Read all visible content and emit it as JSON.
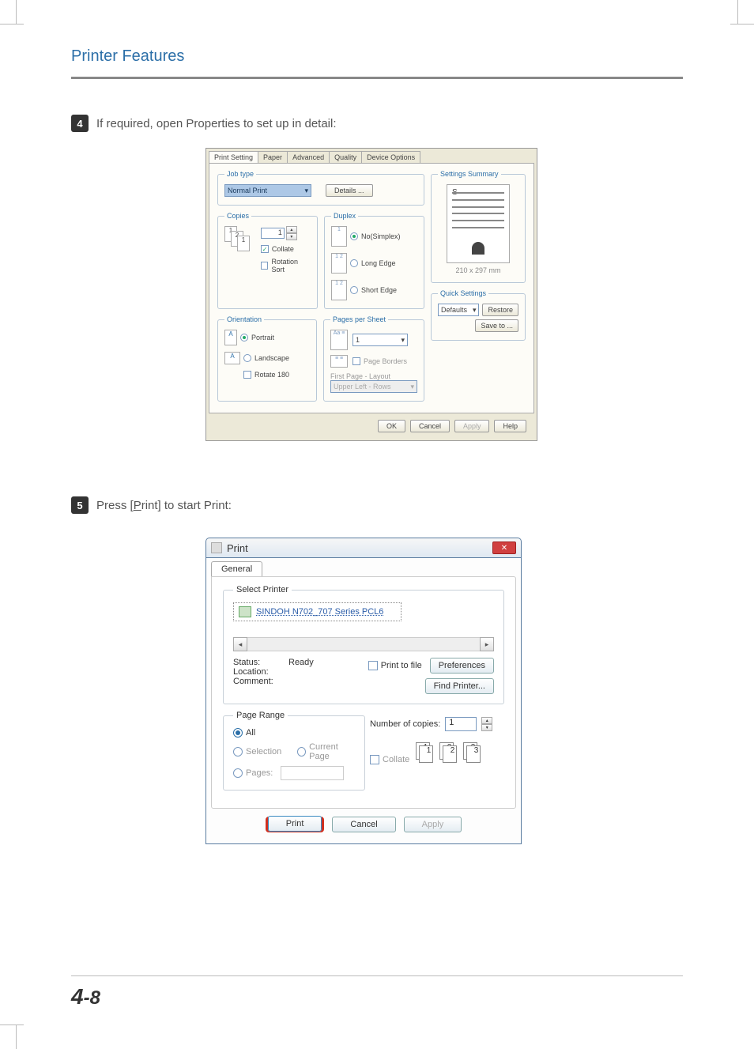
{
  "page": {
    "header": "Printer Features",
    "footer_chapter": "4",
    "footer_sep": "-",
    "footer_page": "8"
  },
  "step4": {
    "num": "4",
    "text": "If required, open Properties to set up in detail:"
  },
  "step5": {
    "num": "5",
    "text_prefix": "Press [",
    "text_key": "P",
    "text_rest": "rint] to start Print:"
  },
  "props": {
    "tabs": [
      "Print Setting",
      "Paper",
      "Advanced",
      "Quality",
      "Device Options"
    ],
    "jobtype": {
      "legend": "Job type",
      "value": "Normal Print",
      "details_btn": "Details ..."
    },
    "copies": {
      "legend": "Copies",
      "value": "1",
      "collate": "Collate",
      "rotation": "Rotation Sort"
    },
    "duplex": {
      "legend": "Duplex",
      "no": "No(Simplex)",
      "long": "Long Edge",
      "short": "Short Edge"
    },
    "orientation": {
      "legend": "Orientation",
      "portrait": "Portrait",
      "landscape": "Landscape",
      "rotate": "Rotate 180"
    },
    "pps": {
      "legend": "Pages per Sheet",
      "value": "1",
      "borders": "Page Borders",
      "first_label": "First Page - Layout",
      "first_value": "Upper Left - Rows"
    },
    "summary": {
      "legend": "Settings Summary",
      "s": "S",
      "dims": "210 x 297 mm"
    },
    "quick": {
      "legend": "Quick Settings",
      "value": "Defaults",
      "restore": "Restore",
      "saveto": "Save to ..."
    },
    "buttons": {
      "ok": "OK",
      "cancel": "Cancel",
      "apply": "Apply",
      "help": "Help"
    }
  },
  "print": {
    "title": "Print",
    "tab": "General",
    "select_printer": {
      "legend": "Select Printer",
      "printer": "SINDOH N702_707 Series PCL6"
    },
    "status_label": "Status:",
    "status_value": "Ready",
    "location_label": "Location:",
    "comment_label": "Comment:",
    "print_to_file": "Print to file",
    "preferences": "Preferences",
    "find_printer": "Find Printer...",
    "page_range": {
      "legend": "Page Range",
      "all": "All",
      "selection": "Selection",
      "current": "Current Page",
      "pages": "Pages:"
    },
    "copies_label": "Number of copies:",
    "copies_value": "1",
    "collate": "Collate",
    "stack": [
      "1",
      "1",
      "2",
      "2",
      "3",
      "3"
    ],
    "buttons": {
      "print": "Print",
      "cancel": "Cancel",
      "apply": "Apply"
    }
  }
}
